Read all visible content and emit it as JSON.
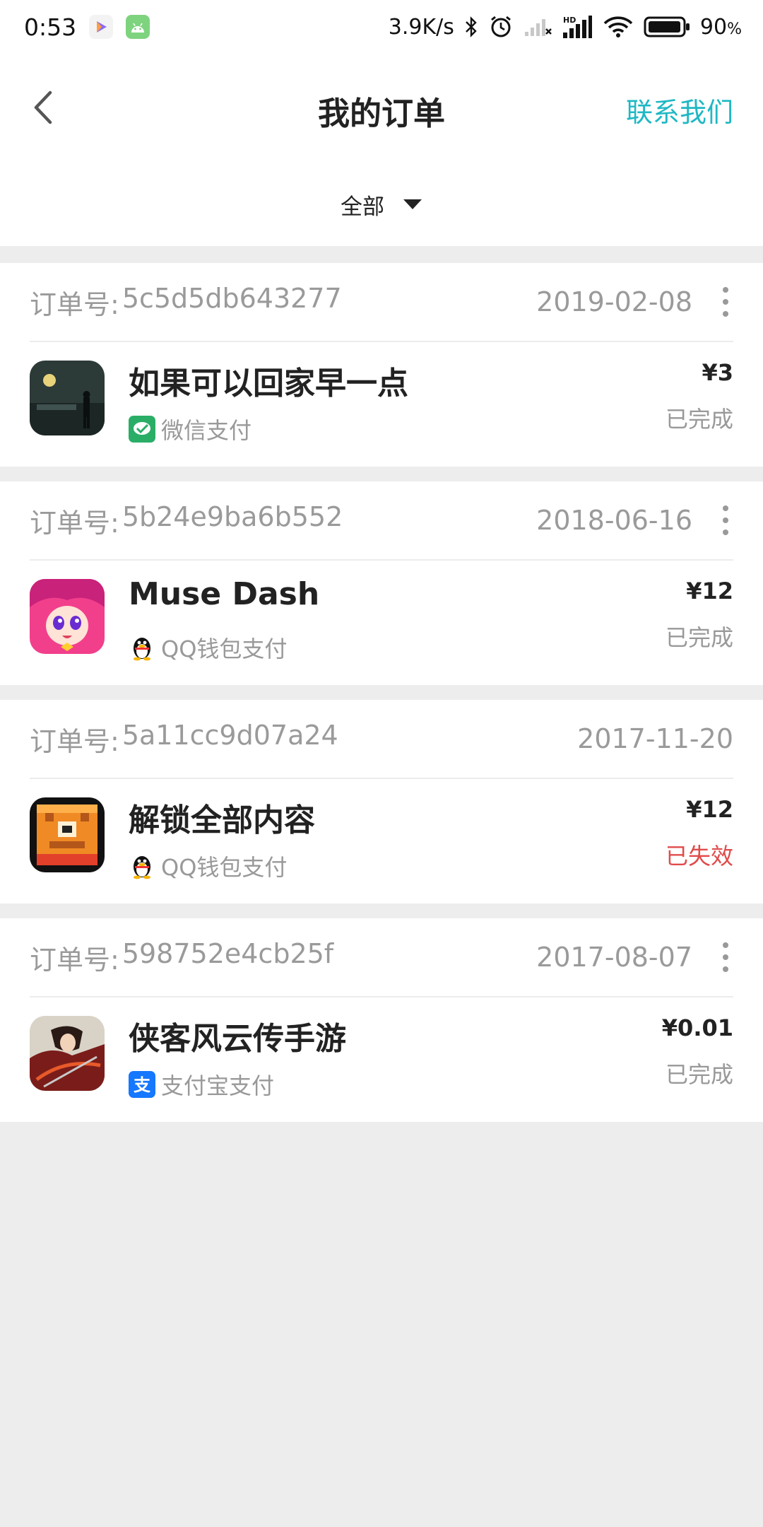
{
  "status_bar": {
    "time": "0:53",
    "net_speed": "3.9K/s",
    "battery": "90",
    "battery_unit": "%"
  },
  "header": {
    "title": "我的订单",
    "contact": "联系我们"
  },
  "filter": {
    "selected": "全部"
  },
  "colors": {
    "accent": "#1fb8c4",
    "invalid": "#e04b4b",
    "muted": "#999999"
  },
  "orders": [
    {
      "order_label": "订单号:",
      "order_no": "5c5d5db643277",
      "date": "2019-02-08",
      "has_more": true,
      "app_name": "如果可以回家早一点",
      "app_icon": "night-silhouette-icon",
      "payment_icon": "wechat-pay-icon",
      "payment": "微信支付",
      "price": "¥3",
      "status": "已完成"
    },
    {
      "order_label": "订单号:",
      "order_no": "5b24e9ba6b552",
      "date": "2018-06-16",
      "has_more": true,
      "app_name": "Muse Dash",
      "app_icon": "anime-girl-icon",
      "payment_icon": "qq-penguin-icon",
      "payment": "QQ钱包支付",
      "price": "¥12",
      "status": "已完成"
    },
    {
      "order_label": "订单号:",
      "order_no": "5a11cc9d07a24",
      "date": "2017-11-20",
      "has_more": false,
      "app_name": "解锁全部内容",
      "app_icon": "pixel-creature-icon",
      "payment_icon": "qq-penguin-icon",
      "payment": "QQ钱包支付",
      "price": "¥12",
      "status": "已失效"
    },
    {
      "order_label": "订单号:",
      "order_no": "598752e4cb25f",
      "date": "2017-08-07",
      "has_more": true,
      "app_name": "侠客风云传手游",
      "app_icon": "swordsman-icon",
      "payment_icon": "alipay-icon",
      "payment": "支付宝支付",
      "price": "¥0.01",
      "status": "已完成"
    }
  ]
}
